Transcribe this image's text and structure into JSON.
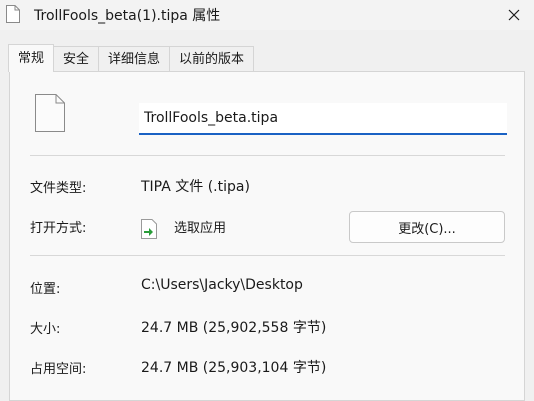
{
  "window": {
    "title": "TrollFools_beta(1).tipa 属性",
    "icons": {
      "title": "file-icon",
      "close": "close-icon"
    }
  },
  "tabs": [
    {
      "label": "常规",
      "active": true
    },
    {
      "label": "安全",
      "active": false
    },
    {
      "label": "详细信息",
      "active": false
    },
    {
      "label": "以前的版本",
      "active": false
    }
  ],
  "general": {
    "file_name": "TrollFools_beta.tipa",
    "file_type_label": "文件类型:",
    "file_type_value": "TIPA 文件 (.tipa)",
    "open_with_label": "打开方式:",
    "open_with_app": "选取应用",
    "open_with_icon": "green-arrow-app-icon",
    "change_button": "更改(C)...",
    "location_label": "位置:",
    "location_value": "C:\\Users\\Jacky\\Desktop",
    "size_label": "大小:",
    "size_value": "24.7 MB (25,902,558 字节)",
    "size_on_disk_label": "占用空间:",
    "size_on_disk_value": "24.7 MB (25,903,104 字节)"
  },
  "colors": {
    "accent": "#1a62c4",
    "background": "#f0f0f0",
    "panel": "#f9f9f9",
    "app_icon_arrow": "#2a9d3a"
  }
}
